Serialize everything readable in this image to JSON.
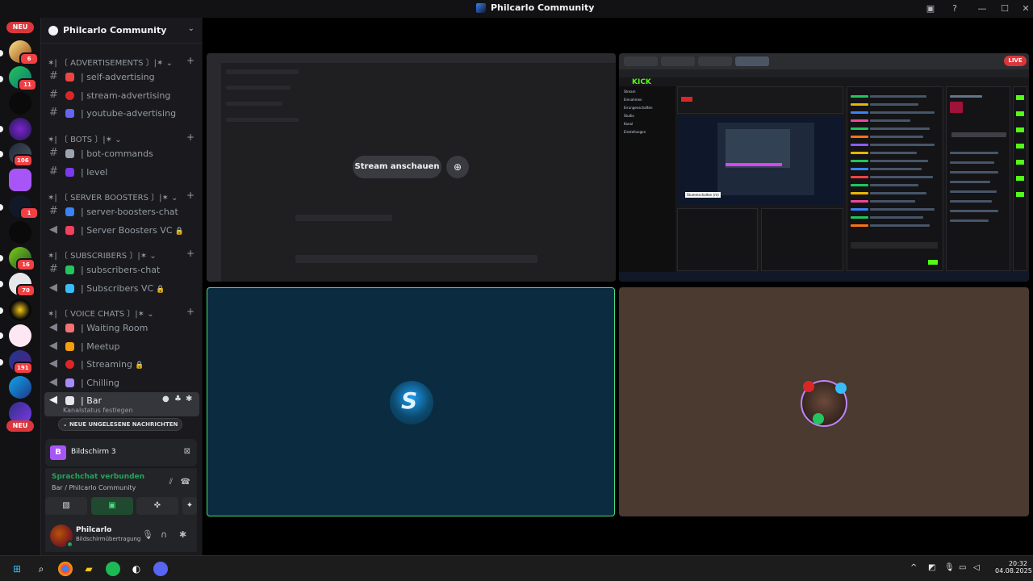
{
  "window": {
    "title": "Philcarlo Community",
    "inbox_icon": "inbox-icon",
    "help_icon": "help-icon",
    "minimize_icon": "minimize-icon",
    "maximize_icon": "maximize-icon",
    "close_icon": "close-icon"
  },
  "rail": {
    "new_top": "NEU",
    "new_bottom": "NEU",
    "badges": [
      "6",
      "11",
      "106",
      "1",
      "16",
      "70",
      "191"
    ]
  },
  "guild": {
    "name": "Philcarlo Community"
  },
  "categories": [
    {
      "label": "✶| 〔 ADVERTISEMENTS 〕|✶"
    },
    {
      "label": "✶| 〔 BOTS 〕|✶"
    },
    {
      "label": "✶| 〔 SERVER BOOSTERS 〕|✶"
    },
    {
      "label": "✶| 〔 SUBSCRIBERS 〕|✶"
    },
    {
      "label": "✶| 〔 VOICE CHATS 〕|✶"
    }
  ],
  "channels": [
    {
      "label": "| self-advertising"
    },
    {
      "label": "| stream-advertising"
    },
    {
      "label": "| youtube-advertising"
    },
    {
      "label": "| bot-commands"
    },
    {
      "label": "| level"
    },
    {
      "label": "| server-boosters-chat"
    },
    {
      "label": "| Server Boosters VC"
    },
    {
      "label": "| subscribers-chat"
    },
    {
      "label": "| Subscribers VC"
    },
    {
      "label": "| Waiting Room"
    },
    {
      "label": "| Meetup"
    },
    {
      "label": "| Streaming"
    },
    {
      "label": "| Chilling"
    },
    {
      "label": "| Bar",
      "status": "Kanalstatus festlegen"
    }
  ],
  "new_messages": "NEUE UNGELESENE NACHRICHTEN",
  "screen_share": {
    "label": "Bildschirm 3",
    "icon_letter": "B"
  },
  "voice": {
    "status": "Sprachchat verbunden",
    "location": "Bar / Philcarlo Community"
  },
  "user": {
    "name": "Philcarlo",
    "status": "Bildschirmübertragung"
  },
  "stage": {
    "watch_button": "Stream anschauen",
    "live": "LIVE",
    "kick_logo": "KICK",
    "kick_nav": [
      "Stream",
      "Einnahmen",
      "Errungenschaften",
      "Studio",
      "Kanal",
      "Einstellungen"
    ],
    "kick_tooltip": "Stummschalten (m)"
  },
  "taskbar": {
    "time": "20:32",
    "date": "04.08.2025"
  },
  "colors": {
    "accent_green": "#23a55a",
    "danger": "#da373c",
    "kick_green": "#53fc18",
    "speaking_border": "#4ade80"
  }
}
